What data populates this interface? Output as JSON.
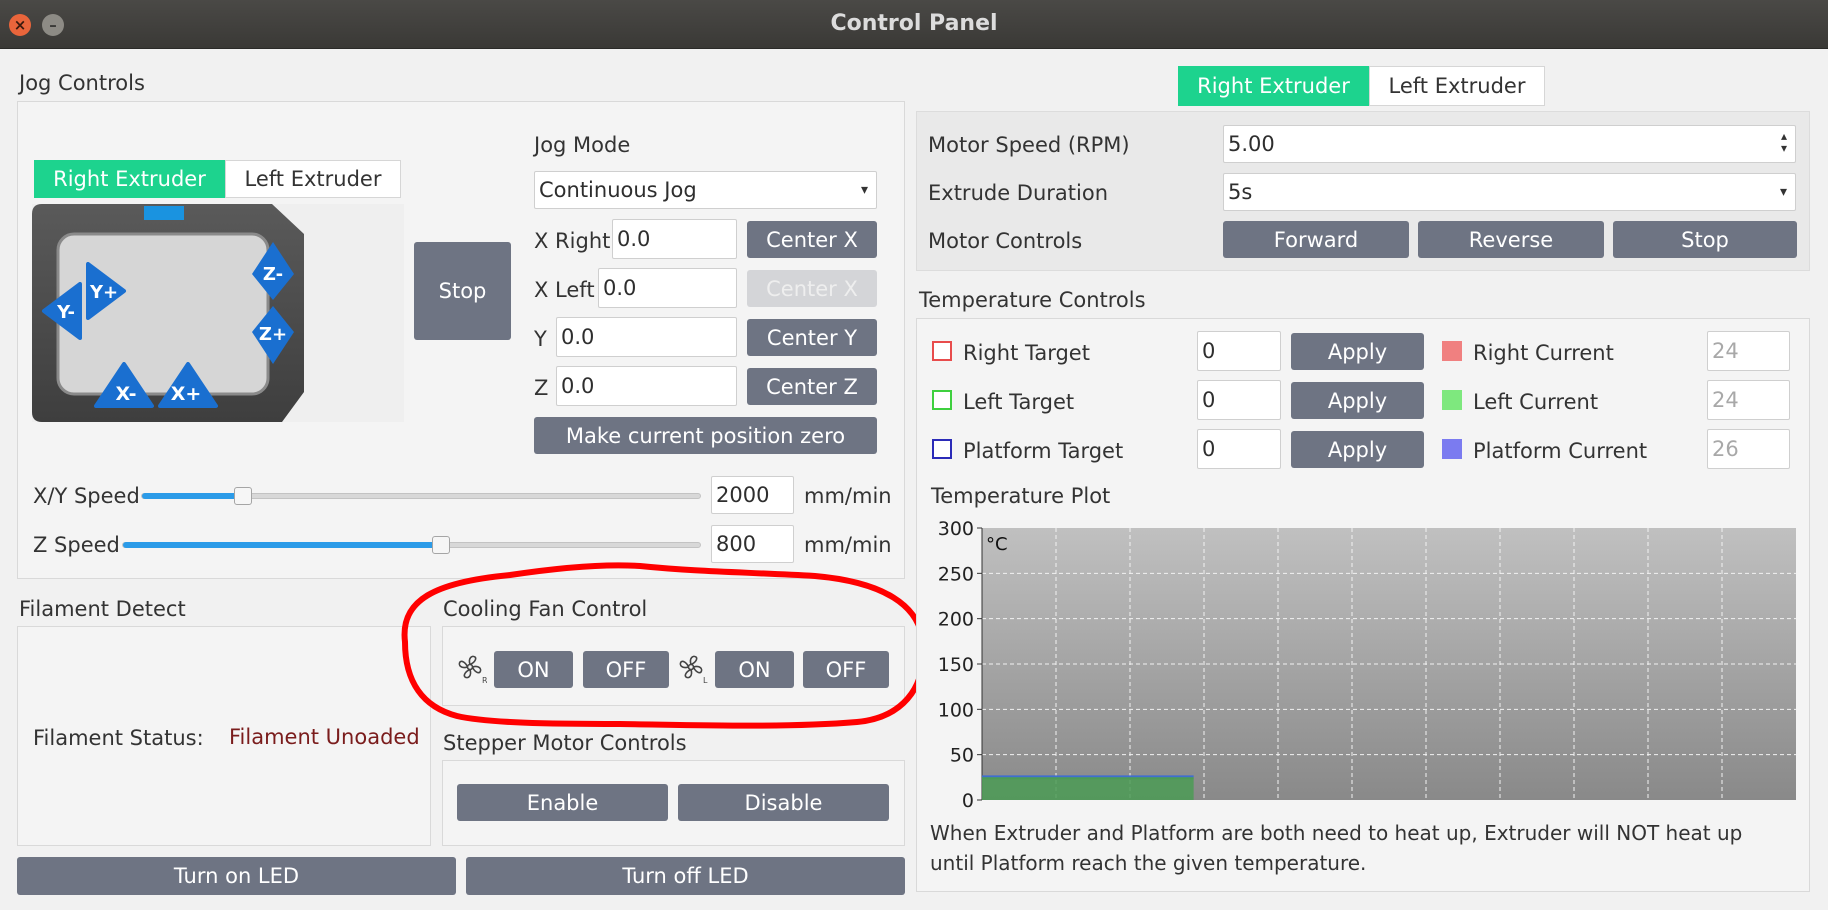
{
  "window": {
    "title": "Control Panel",
    "close_glyph": "×",
    "min_glyph": "–"
  },
  "jog": {
    "section_title": "Jog Controls",
    "tabs": [
      "Right Extruder",
      "Left Extruder"
    ],
    "pad_labels": {
      "y_minus": "Y-",
      "y_plus": "Y+",
      "z_minus": "Z-",
      "z_plus": "Z+",
      "x_minus": "X-",
      "x_plus": "X+"
    },
    "stop_label": "Stop",
    "mode_label": "Jog Mode",
    "mode_value": "Continuous Jog",
    "x_right_label": "X Right",
    "x_right_value": "0.0",
    "center_x_label": "Center X",
    "x_left_label": "X Left",
    "x_left_value": "0.0",
    "center_x_disabled_label": "Center X",
    "y_label": "Y",
    "y_value": "0.0",
    "center_y_label": "Center Y",
    "z_label": "Z",
    "z_value": "0.0",
    "center_z_label": "Center Z",
    "zero_label": "Make current position zero",
    "xy_speed_label": "X/Y Speed",
    "xy_speed_value": "2000",
    "xy_speed_unit": "mm/min",
    "xy_speed_fraction": 0.18,
    "z_speed_label": "Z Speed",
    "z_speed_value": "800",
    "z_speed_unit": "mm/min",
    "z_speed_fraction": 0.55
  },
  "filament": {
    "section_title": "Filament Detect",
    "status_label": "Filament Status:",
    "status_value": "Filament Unoaded",
    "status_color": "#7a1c1c"
  },
  "fan": {
    "section_title": "Cooling Fan Control",
    "right_icon_sub": "R",
    "left_icon_sub": "L",
    "right_on": "ON",
    "right_off": "OFF",
    "left_on": "ON",
    "left_off": "OFF"
  },
  "stepper": {
    "section_title": "Stepper Motor Controls",
    "enable": "Enable",
    "disable": "Disable"
  },
  "led": {
    "on": "Turn on LED",
    "off": "Turn off LED"
  },
  "extruder": {
    "tabs": [
      "Right Extruder",
      "Left Extruder"
    ],
    "motor_speed_label": "Motor Speed (RPM)",
    "motor_speed_value": "5.00",
    "duration_label": "Extrude Duration",
    "duration_value": "5s",
    "motor_controls_label": "Motor Controls",
    "forward": "Forward",
    "reverse": "Reverse",
    "stop": "Stop"
  },
  "temperature": {
    "section_title": "Temperature Controls",
    "rows": [
      {
        "target_label": "Right Target",
        "target_value": "0",
        "apply": "Apply",
        "current_label": "Right Current",
        "current_value": "24",
        "color": "#e84c4c",
        "fill": "#f08080"
      },
      {
        "target_label": "Left Target",
        "target_value": "0",
        "apply": "Apply",
        "current_label": "Left Current",
        "current_value": "24",
        "color": "#3fd03f",
        "fill": "#7ee87e"
      },
      {
        "target_label": "Platform Target",
        "target_value": "0",
        "apply": "Apply",
        "current_label": "Platform Current",
        "current_value": "26",
        "color": "#2b2bb8",
        "fill": "#7b7bf0"
      }
    ],
    "plot_title": "Temperature Plot",
    "unit": "°C",
    "y_ticks": [
      "300",
      "250",
      "200",
      "150",
      "100",
      "50",
      "0"
    ],
    "note": "When Extruder and Platform are both need to heat up, Extruder will NOT heat up until Platform reach the given temperature."
  },
  "chart_data": {
    "type": "line",
    "ylim": [
      0,
      300
    ],
    "yticks": [
      0,
      50,
      100,
      150,
      200,
      250,
      300
    ],
    "grid": true,
    "series": [
      {
        "color": "#3f6ecf",
        "values": [
          26,
          26
        ]
      },
      {
        "color": "#4b9b55",
        "values": [
          24,
          24
        ]
      }
    ]
  }
}
